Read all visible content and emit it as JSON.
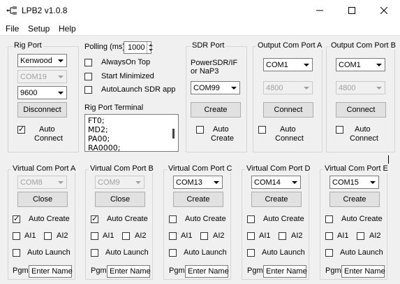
{
  "window": {
    "title": "LPB2 v1.0.8"
  },
  "menu": [
    "File",
    "Setup",
    "Help"
  ],
  "rig_port": {
    "legend": "Rig Port",
    "radio": "Kenwood",
    "com": "COM19",
    "baud": "9600",
    "disconnect": "Disconnect",
    "auto_connect": {
      "line1": "Auto",
      "line2": "Connect",
      "checked": true
    }
  },
  "polling": {
    "label": "Polling (ms)",
    "value": "1000"
  },
  "options": {
    "always_on_top": "AlwaysOn Top",
    "start_minimized": "Start Minimized",
    "autolaunch": "AutoLaunch SDR app"
  },
  "terminal": {
    "label": "Rig Port Terminal",
    "lines": [
      "FT0;",
      "MD2;",
      "PA00;",
      "RA0000;"
    ]
  },
  "sdr_port": {
    "legend": "SDR Port",
    "desc1": "PowerSDR/IF",
    "desc2": "or NaP3",
    "com": "COM99",
    "create": "Create",
    "auto1": "Auto",
    "auto2": "Create"
  },
  "out_a": {
    "legend": "Output Com Port A",
    "com": "COM1",
    "baud": "4800",
    "btn": "Connect",
    "auto1": "Auto",
    "auto2": "Connect"
  },
  "out_b": {
    "legend": "Output Com Port B",
    "com": "COM1",
    "baud": "4800",
    "btn": "Connect",
    "auto1": "Auto",
    "auto2": "Connect"
  },
  "vports": [
    {
      "legend": "Virtual Com Port A",
      "com": "COM8",
      "disabled": true,
      "btn": "Close",
      "auto_create": true
    },
    {
      "legend": "Virtual Com Port B",
      "com": "COM9",
      "disabled": true,
      "btn": "Close",
      "auto_create": true
    },
    {
      "legend": "Virtual Com Port C",
      "com": "COM13",
      "disabled": false,
      "btn": "Create",
      "auto_create": false
    },
    {
      "legend": "Virtual Com Port D",
      "com": "COM14",
      "disabled": false,
      "btn": "Create",
      "auto_create": false
    },
    {
      "legend": "Virtual Com Port E",
      "com": "COM15",
      "disabled": false,
      "btn": "Create",
      "auto_create": false
    }
  ],
  "vport_labels": {
    "auto_create": "Auto Create",
    "ai1": "AI1",
    "ai2": "AI2",
    "auto_launch": "Auto Launch",
    "pgm": "Pgm",
    "enter_name": "Enter Name"
  }
}
